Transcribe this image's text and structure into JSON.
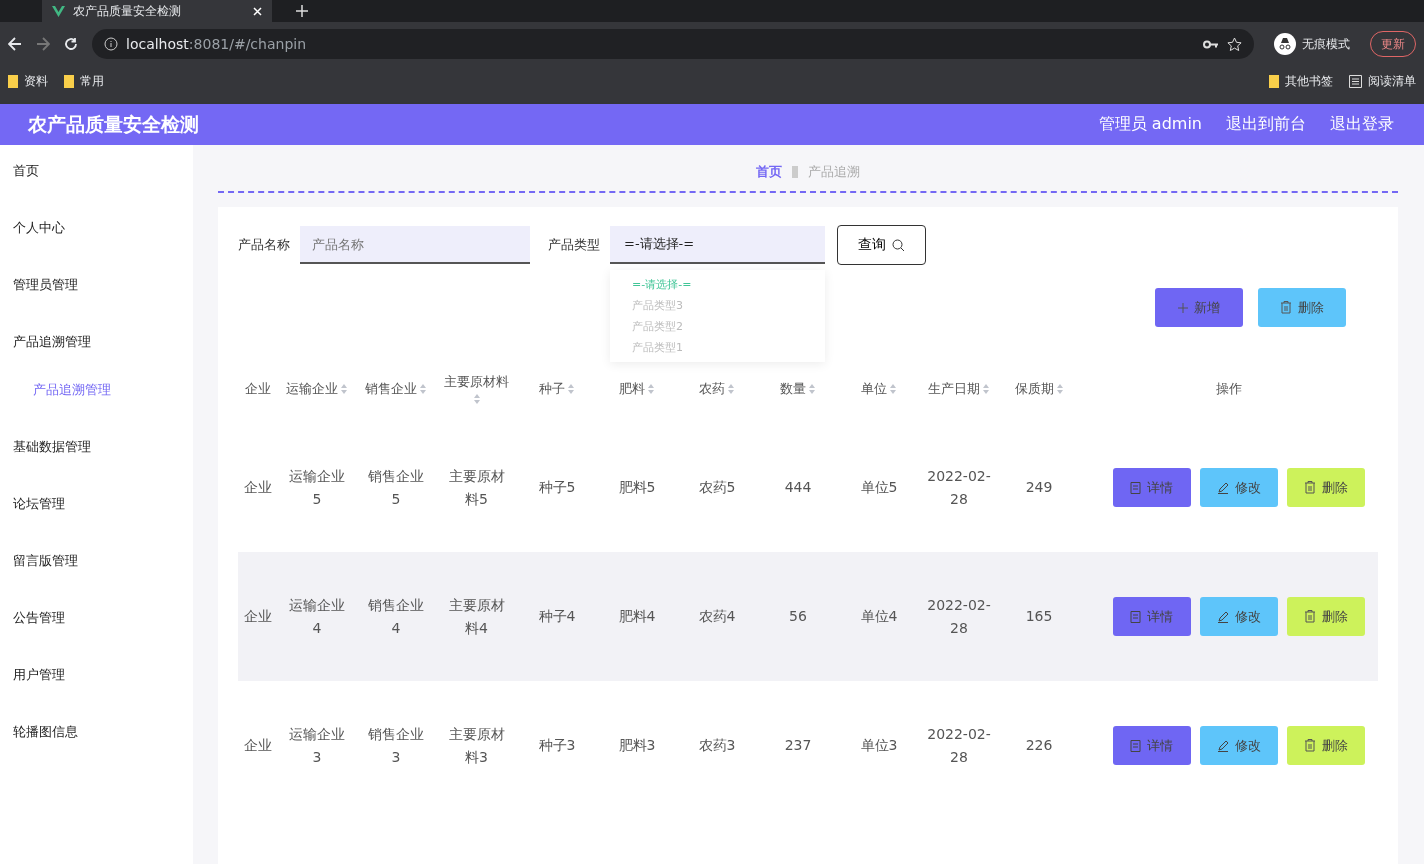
{
  "browser": {
    "tabs": [
      {
        "title": "农产品质量安全检测",
        "selected": true
      }
    ],
    "url_host": "localhost",
    "url_rest": ":8081/#/chanpin",
    "profile": "无痕模式",
    "update": "更新",
    "bookmarks": [
      "资料",
      "常用"
    ],
    "bookmarks_right": [
      {
        "kind": "folder",
        "label": "其他书签"
      },
      {
        "kind": "list",
        "label": "阅读清单"
      }
    ]
  },
  "header": {
    "title": "农产品质量安全检测",
    "user": "管理员 admin",
    "links": [
      "退出到前台",
      "退出登录"
    ]
  },
  "sidebar": {
    "items": [
      {
        "label": "首页",
        "selected": false
      },
      {
        "label": "个人中心",
        "selected": false
      },
      {
        "label": "管理员管理",
        "selected": false
      },
      {
        "label": "产品追溯管理",
        "selected": false,
        "children": [
          {
            "label": "产品追溯管理",
            "selected": true
          }
        ]
      },
      {
        "label": "基础数据管理",
        "selected": false
      },
      {
        "label": "论坛管理",
        "selected": false
      },
      {
        "label": "留言版管理",
        "selected": false
      },
      {
        "label": "公告管理",
        "selected": false
      },
      {
        "label": "用户管理",
        "selected": false
      },
      {
        "label": "轮播图信息",
        "selected": false
      }
    ]
  },
  "breadcrumb": [
    "首页",
    "产品追溯"
  ],
  "search": {
    "name_label": "产品名称",
    "name_placeholder": "产品名称",
    "type_label": "产品类型",
    "type_value": "=-请选择-=",
    "query": "查询",
    "options": [
      {
        "label": "=-请选择-=",
        "selected": true
      },
      {
        "label": "产品类型3",
        "selected": false
      },
      {
        "label": "产品类型2",
        "selected": false
      },
      {
        "label": "产品类型1",
        "selected": false
      }
    ]
  },
  "actions": [
    {
      "kind": "add",
      "label": "新增"
    },
    {
      "kind": "delete",
      "label": "删除"
    }
  ],
  "table": {
    "columns": [
      {
        "label": "企业",
        "sortable": false
      },
      {
        "label": "运输企业",
        "sortable": true
      },
      {
        "label": "销售企业",
        "sortable": true
      },
      {
        "label": "主要原材料",
        "sortable": true
      },
      {
        "label": "种子",
        "sortable": true
      },
      {
        "label": "肥料",
        "sortable": true
      },
      {
        "label": "农药",
        "sortable": true
      },
      {
        "label": "数量",
        "sortable": true
      },
      {
        "label": "单位",
        "sortable": true
      },
      {
        "label": "生产日期",
        "sortable": true
      },
      {
        "label": "保质期",
        "sortable": true
      },
      {
        "label": "操作",
        "sortable": false
      }
    ],
    "rows": [
      {
        "cells": [
          "企业",
          "运输企业5",
          "销售企业5",
          "主要原材料5",
          "种子5",
          "肥料5",
          "农药5",
          "444",
          "单位5",
          "2022-02-28",
          "249"
        ],
        "actions": [
          {
            "kind": "detail",
            "label": "详情"
          },
          {
            "kind": "edit",
            "label": "修改"
          },
          {
            "kind": "delete",
            "label": "删除"
          }
        ]
      },
      {
        "cells": [
          "企业",
          "运输企业4",
          "销售企业4",
          "主要原材料4",
          "种子4",
          "肥料4",
          "农药4",
          "56",
          "单位4",
          "2022-02-28",
          "165"
        ],
        "actions": [
          {
            "kind": "detail",
            "label": "详情"
          },
          {
            "kind": "edit",
            "label": "修改"
          },
          {
            "kind": "delete",
            "label": "删除"
          }
        ]
      },
      {
        "cells": [
          "企业",
          "运输企业3",
          "销售企业3",
          "主要原材料3",
          "种子3",
          "肥料3",
          "农药3",
          "237",
          "单位3",
          "2022-02-28",
          "226"
        ],
        "actions": [
          {
            "kind": "detail",
            "label": "详情"
          },
          {
            "kind": "edit",
            "label": "修改"
          },
          {
            "kind": "delete",
            "label": "删除"
          }
        ]
      }
    ]
  }
}
